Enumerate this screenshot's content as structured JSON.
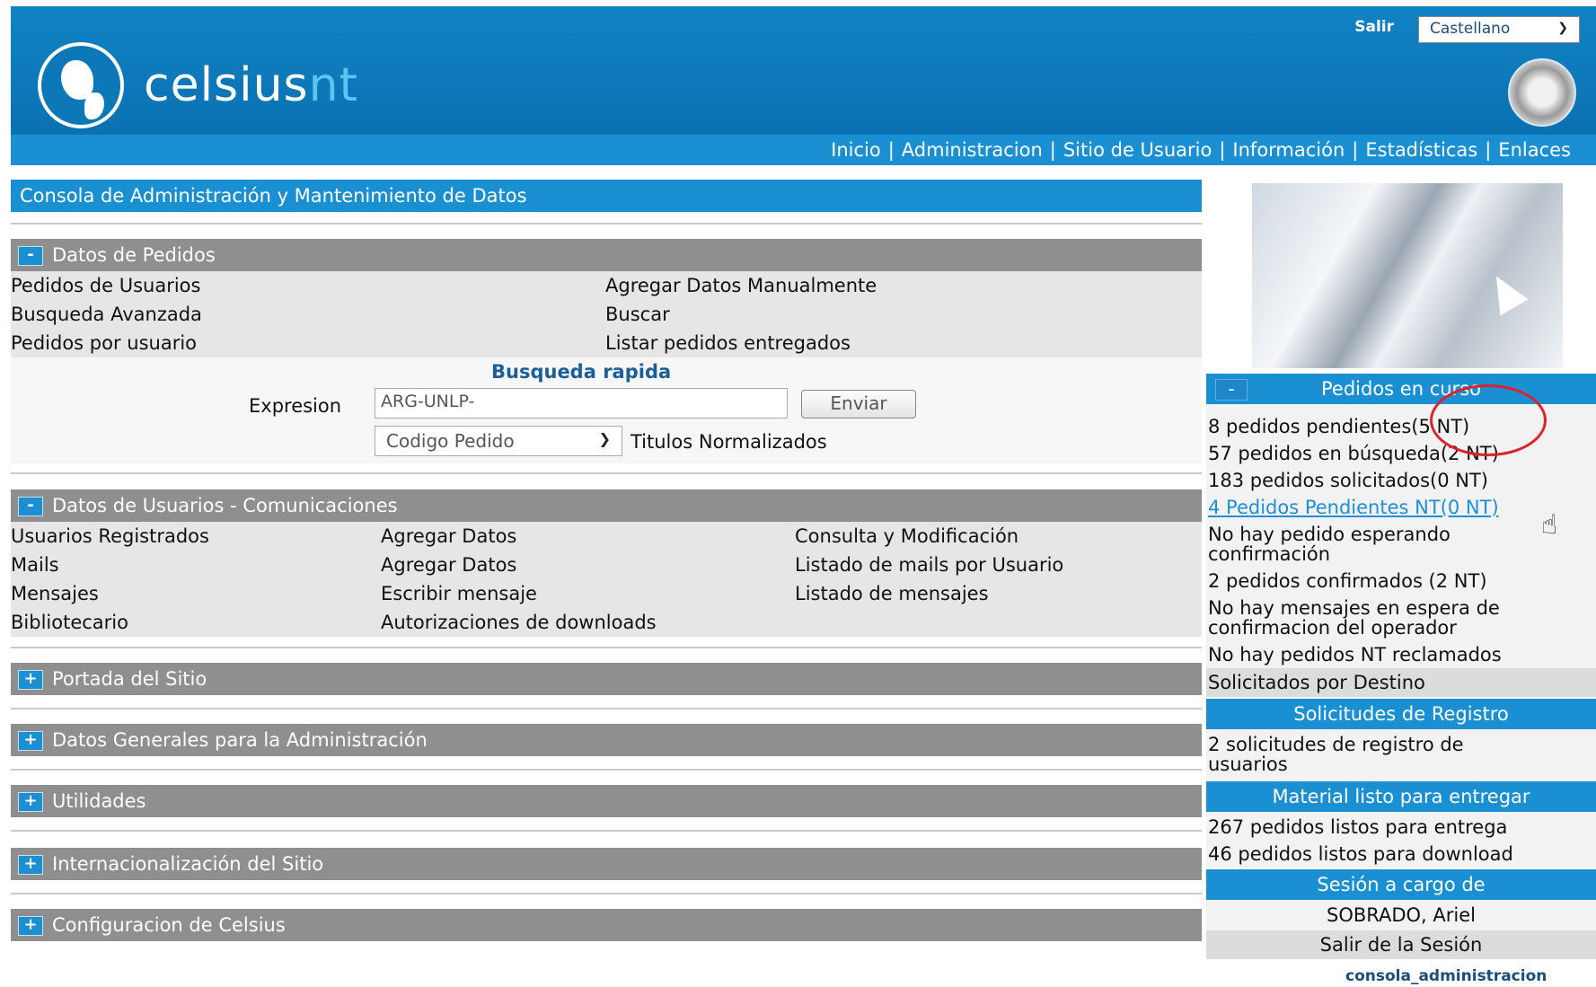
{
  "header": {
    "logo_main": "celsius",
    "logo_accent": "nt",
    "salir": "Salir",
    "language": "Castellano"
  },
  "nav": [
    "Inicio",
    "Administracion",
    "Sitio de Usuario",
    "Información",
    "Estadísticas",
    "Enlaces"
  ],
  "console_title": "Consola de Administración y Mantenimiento de Datos",
  "pedidos": {
    "title": "Datos de Pedidos",
    "toggle": "-",
    "col1": [
      "Pedidos de Usuarios",
      "Busqueda Avanzada",
      "Pedidos por usuario"
    ],
    "col2": [
      "Agregar Datos Manualmente",
      "Buscar",
      "Listar pedidos entregados"
    ]
  },
  "quick_search": {
    "title": "Busqueda rapida",
    "label": "Expresion",
    "value": "ARG-UNLP-",
    "button": "Enviar",
    "select_value": "Codigo Pedido",
    "checkbox_label": "Titulos Normalizados"
  },
  "usuarios": {
    "title": "Datos de Usuarios - Comunicaciones",
    "toggle": "-",
    "col1": [
      "Usuarios Registrados",
      "Mails",
      "Mensajes",
      "Bibliotecario"
    ],
    "col2": [
      "Agregar Datos",
      "Agregar Datos",
      "Escribir mensaje",
      "Autorizaciones de downloads"
    ],
    "col3": [
      "Consulta y Modificación",
      "Listado de mails por Usuario",
      "Listado de mensajes"
    ]
  },
  "collapsed_sections": [
    {
      "title": "Portada del Sitio",
      "toggle": "+"
    },
    {
      "title": "Datos Generales para la Administración",
      "toggle": "+"
    },
    {
      "title": "Utilidades",
      "toggle": "+"
    },
    {
      "title": "Internacionalización del Sitio",
      "toggle": "+"
    },
    {
      "title": "Configuracion de Celsius",
      "toggle": "+"
    }
  ],
  "sidebar": {
    "pedidos_curso": {
      "title": "Pedidos en curso",
      "toggle": "-",
      "items": [
        "8 pedidos pendientes(5 NT)",
        "57 pedidos en búsqueda(2 NT)",
        "183 pedidos solicitados(0 NT)",
        "4 Pedidos Pendientes NT(0 NT)",
        "No hay pedido esperando",
        "confirmación",
        "2 pedidos confirmados (2 NT)",
        "No hay mensajes en espera de",
        "confirmacion del operador",
        "No hay pedidos NT reclamados"
      ],
      "solicitados_destino": "Solicitados por Destino"
    },
    "registro": {
      "title": "Solicitudes de Registro",
      "line1": "2 solicitudes de registro de",
      "line2": "usuarios"
    },
    "material": {
      "title": "Material listo para entregar",
      "items": [
        "267 pedidos listos para entrega",
        "46 pedidos listos para download"
      ]
    },
    "sesion": {
      "title": "Sesión a cargo de",
      "user": "SOBRADO, Ariel",
      "logout": "Salir de la Sesión"
    }
  },
  "footer": "consola_administracion"
}
